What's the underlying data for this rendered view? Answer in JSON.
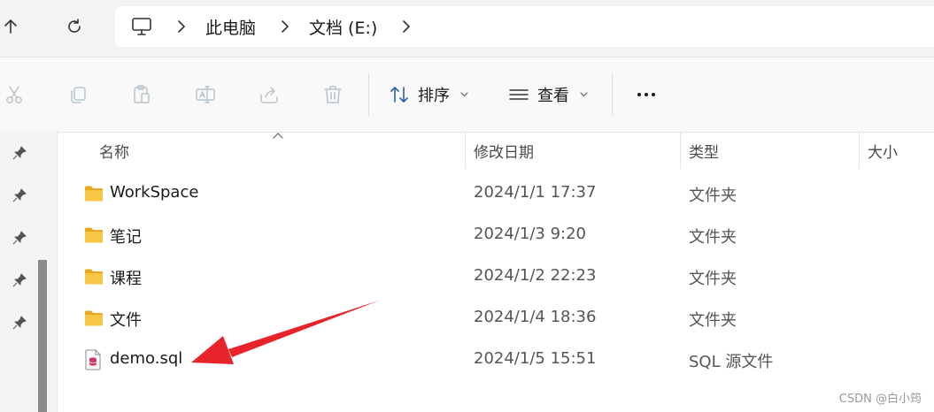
{
  "address_bar": {
    "computer_icon": "computer-icon",
    "breadcrumbs": [
      "此电脑",
      "文档 (E:)"
    ]
  },
  "command_bar": {
    "icons": [
      "cut-icon",
      "copy-icon",
      "paste-icon",
      "rename-icon",
      "share-icon",
      "delete-icon"
    ],
    "sort_label": "排序",
    "view_label": "查看",
    "more_icon": "more-icon"
  },
  "columns": {
    "name": "名称",
    "date_modified": "修改日期",
    "type": "类型",
    "size": "大小"
  },
  "files": [
    {
      "name": "WorkSpace",
      "date": "2024/1/1 17:37",
      "type": "文件夹",
      "icon": "folder-icon"
    },
    {
      "name": "笔记",
      "date": "2024/1/3 9:20",
      "type": "文件夹",
      "icon": "folder-icon"
    },
    {
      "name": "课程",
      "date": "2024/1/2 22:23",
      "type": "文件夹",
      "icon": "folder-icon"
    },
    {
      "name": "文件",
      "date": "2024/1/4 18:36",
      "type": "文件夹",
      "icon": "folder-icon"
    },
    {
      "name": "demo.sql",
      "date": "2024/1/5 15:51",
      "type": "SQL 源文件",
      "icon": "sql-file-icon"
    }
  ],
  "colors": {
    "folder": "#f7c645",
    "annotation_arrow": "#e8232a",
    "scroll_thumb": "#8a8a8a"
  },
  "watermark": "CSDN @白小筠"
}
